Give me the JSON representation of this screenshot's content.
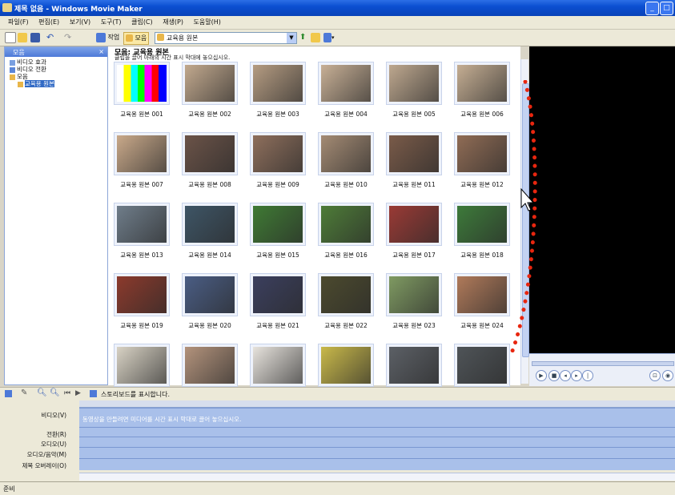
{
  "window": {
    "title": "제목 없음 - Windows Movie Maker"
  },
  "menu": [
    "파일(F)",
    "편집(E)",
    "보기(V)",
    "도구(T)",
    "클립(C)",
    "재생(P)",
    "도움말(H)"
  ],
  "toolbar": {
    "tasks_label": "작업",
    "collections_label": "모음",
    "collection_value": "교육용 원본"
  },
  "sidebar": {
    "header": "모음",
    "close": "×",
    "items": [
      {
        "label": "비디오 효과"
      },
      {
        "label": "비디오 전환"
      },
      {
        "label": "모음"
      },
      {
        "label": "교육용 원본"
      }
    ]
  },
  "content": {
    "title": "모음: 교육용 원본",
    "subtitle": "클립을 끌어 아래의 시간 표시 막대에 놓으십시오.",
    "clips": [
      "교육용 원본 001",
      "교육용 원본 002",
      "교육용 원본 003",
      "교육용 원본 004",
      "교육용 원본 005",
      "교육용 원본 006",
      "교육용 원본 007",
      "교육용 원본 008",
      "교육용 원본 009",
      "교육용 원본 010",
      "교육용 원본 011",
      "교육용 원본 012",
      "교육용 원본 013",
      "교육용 원본 014",
      "교육용 원본 015",
      "교육용 원본 016",
      "교육용 원본 017",
      "교육용 원본 018",
      "교육용 원본 019",
      "교육용 원본 020",
      "교육용 원본 021",
      "교육용 원본 022",
      "교육용 원본 023",
      "교육용 원본 024",
      "",
      "",
      "",
      "",
      "",
      ""
    ],
    "thumb_colors": [
      "#8c8c8c",
      "#c2a98e",
      "#b59c82",
      "#c8b096",
      "#bea88f",
      "#c5ae93",
      "#c9a98a",
      "#6b5348",
      "#8e6f5c",
      "#a48b74",
      "#7a5b49",
      "#906c55",
      "#6f7d8a",
      "#3e5566",
      "#3f7a34",
      "#4e7c38",
      "#9a3a35",
      "#3d7a3a",
      "#8c3a2c",
      "#4a5d84",
      "#3b3f5e",
      "#4c4a2e",
      "#7f9a62",
      "#b07a5a",
      "#d8d2c4",
      "#b3937c",
      "#e7e3dd",
      "#c9b94a",
      "#5c6066",
      "#4f5458"
    ]
  },
  "preview": {},
  "timeline": {
    "toolbar_label": "스토리보드를 표시합니다.",
    "tracks": [
      {
        "label": "비디오(V)",
        "hint": "동영상을 만들려면 미디어를 시간 표시 막대로 끌어 놓으십시오."
      },
      {
        "label": "전환(R)",
        "hint": ""
      },
      {
        "label": "오디오(U)",
        "hint": ""
      },
      {
        "label": "오디오/음악(M)",
        "hint": ""
      },
      {
        "label": "제목 오버레이(O)",
        "hint": ""
      }
    ]
  },
  "status": {
    "text": "준비"
  }
}
